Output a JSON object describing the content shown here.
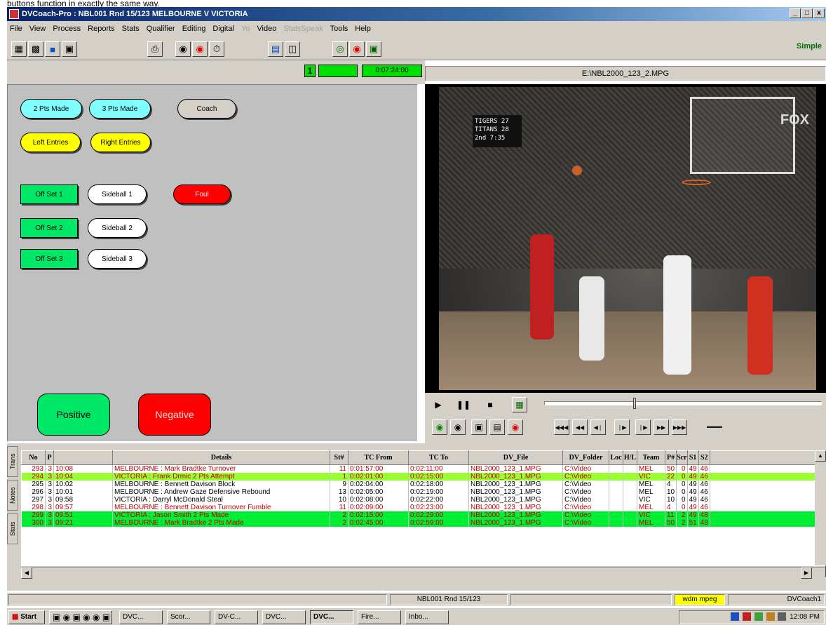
{
  "caption": "buttons function in exactly the same way.",
  "window": {
    "title": "DVCoach-Pro : NBL001 Rnd 15/123 MELBOURNE V VICTORIA",
    "min": "_",
    "max": "□",
    "close": "x"
  },
  "menu": [
    "File",
    "View",
    "Process",
    "Reports",
    "Stats",
    "Qualifier",
    "Editing",
    "Digital",
    "Yo",
    "Video",
    "StatsSpeak",
    "Tools",
    "Help"
  ],
  "menu_disabled": [
    "Yo",
    "StatsSpeak"
  ],
  "toolbar": {
    "mode": "Simple"
  },
  "timecode": {
    "slot": "1",
    "time": "0:07:24:00"
  },
  "file": {
    "name": "E:\\NBL2000_123_2.MPG"
  },
  "buttons": {
    "two_pts_made": "2 Pts Made",
    "three_pts_made": "3 Pts Made",
    "coach": "Coach",
    "left_entries": "Left Entries",
    "right_entries": "Right Entries",
    "off_set_1": "Off Set 1",
    "off_set_2": "Off Set 2",
    "off_set_3": "Off Set 3",
    "sideball_1": "Sideball 1",
    "sideball_2": "Sideball 2",
    "sideball_3": "Sideball 3",
    "foul": "Foul",
    "positive": "Positive",
    "negative": "Negative"
  },
  "video": {
    "scoreboard": [
      "TIGERS  27",
      "TITANS  28",
      "2nd     7:35"
    ],
    "logo": "FOX"
  },
  "grid": {
    "tabs": [
      "Trans",
      "Notes",
      "Stats"
    ],
    "columns": [
      "No",
      "P",
      "",
      "Details",
      "St#",
      "TC From",
      "TC To",
      "DV_File",
      "DV_Folder",
      "Loc",
      "H/L",
      "Team",
      "P#",
      "Scr",
      "S1",
      "S2"
    ],
    "rows": [
      {
        "style": "red",
        "no": "293",
        "p": "3",
        "t": "10:08",
        "details": "MELBOURNE : Mark Bradtke  Turnover",
        "st": "11",
        "from": "0:01:57:00",
        "to": "0:02:11:00",
        "file": "NBL2000_123_1.MPG",
        "folder": "C:\\Video",
        "team": "MEL",
        "pn": "50",
        "scr": "0",
        "s1": "49",
        "s2": "46"
      },
      {
        "style": "lime",
        "no": "294",
        "p": "3",
        "t": "10:04",
        "details": "VICTORIA : Frank Drmic  2 Pts Attempt",
        "st": "1",
        "from": "0:02:01:00",
        "to": "0:02:15:00",
        "file": "NBL2000_123_1.MPG",
        "folder": "C:\\Video",
        "team": "VIC",
        "pn": "22",
        "scr": "0",
        "s1": "49",
        "s2": "46"
      },
      {
        "style": "black",
        "no": "295",
        "p": "3",
        "t": "10:02",
        "details": "MELBOURNE : Bennett Davison  Block",
        "st": "9",
        "from": "0:02:04:00",
        "to": "0:02:18:00",
        "file": "NBL2000_123_1.MPG",
        "folder": "C:\\Video",
        "team": "MEL",
        "pn": "4",
        "scr": "0",
        "s1": "49",
        "s2": "46"
      },
      {
        "style": "black",
        "no": "296",
        "p": "3",
        "t": "10:01",
        "details": "MELBOURNE : Andrew Gaze  Defensive Rebound",
        "st": "13",
        "from": "0:02:05:00",
        "to": "0:02:19:00",
        "file": "NBL2000_123_1.MPG",
        "folder": "C:\\Video",
        "team": "MEL",
        "pn": "10",
        "scr": "0",
        "s1": "49",
        "s2": "46"
      },
      {
        "style": "black",
        "no": "297",
        "p": "3",
        "t": "09:58",
        "details": "VICTORIA : Darryl McDonald  Steal",
        "st": "10",
        "from": "0:02:08:00",
        "to": "0:02:22:00",
        "file": "NBL2000_123_1.MPG",
        "folder": "C:\\Video",
        "team": "VIC",
        "pn": "10",
        "scr": "0",
        "s1": "49",
        "s2": "46"
      },
      {
        "style": "red",
        "no": "298",
        "p": "3",
        "t": "09:57",
        "details": "MELBOURNE : Bennett Davison  Turnover Fumble",
        "st": "11",
        "from": "0:02:09:00",
        "to": "0:02:23:00",
        "file": "NBL2000_123_1.MPG",
        "folder": "C:\\Video",
        "team": "MEL",
        "pn": "4",
        "scr": "0",
        "s1": "49",
        "s2": "46"
      },
      {
        "style": "green",
        "no": "299",
        "p": "3",
        "t": "09:51",
        "details": "VICTORIA : Jason Smith  2 Pts Made",
        "st": "2",
        "from": "0:02:15:00",
        "to": "0:02:29:00",
        "file": "NBL2000_123_1.MPG",
        "folder": "C:\\Video",
        "team": "VIC",
        "pn": "11",
        "scr": "2",
        "s1": "49",
        "s2": "48"
      },
      {
        "style": "green",
        "no": "300",
        "p": "3",
        "t": "09:21",
        "details": "MELBOURNE : Mark Bradtke  2 Pts Made",
        "st": "2",
        "from": "0:02:45:00",
        "to": "0:02:59:00",
        "file": "NBL2000_123_1.MPG",
        "folder": "C:\\Video",
        "team": "MEL",
        "pn": "50",
        "scr": "2",
        "s1": "51",
        "s2": "48"
      }
    ]
  },
  "status": {
    "round": "NBL001 Rnd 15/123",
    "codec": "wdm mpeg",
    "user": "DVCoach1"
  },
  "taskbar": {
    "start": "Start",
    "tasks": [
      "DVC...",
      "Scor...",
      "DV-C...",
      "DVC...",
      "DVC...",
      "Fire...",
      "Inbo..."
    ],
    "clock": "12:08 PM"
  },
  "colors": {
    "titlebar": "#0a246a",
    "green_btn": "#00e868",
    "red_btn": "#ff0000",
    "cyan_btn": "#80ffff",
    "yellow_btn": "#ffff00",
    "timecode_bg": "#00e000"
  }
}
